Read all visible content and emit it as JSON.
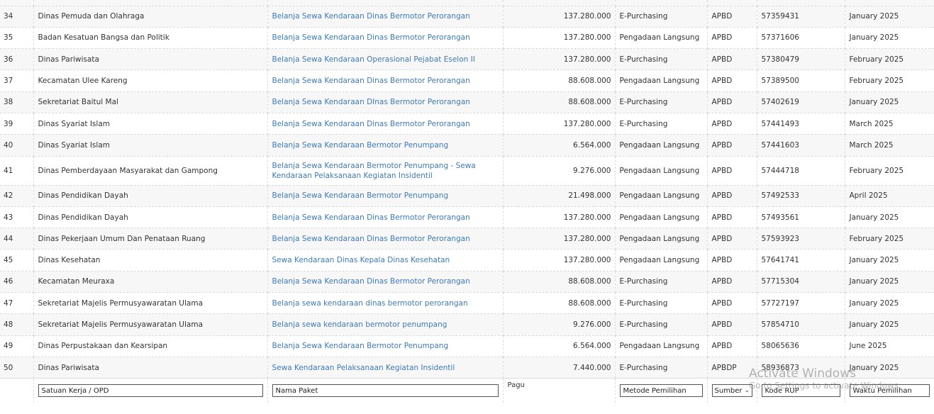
{
  "table": {
    "rows": [
      {
        "no": "34",
        "opd": "Dinas Pemuda dan Olahraga",
        "paket": "Belanja Sewa Kendaraan Dinas Bermotor Perorangan",
        "pagu": "137.280.000",
        "metode": "E-Purchasing",
        "sumber": "APBD",
        "kode": "57359431",
        "waktu": "January 2025"
      },
      {
        "no": "35",
        "opd": "Badan Kesatuan Bangsa dan Politik",
        "paket": "Belanja Sewa Kendaraan Dinas Bermotor Perorangan",
        "pagu": "137.280.000",
        "metode": "Pengadaan Langsung",
        "sumber": "APBD",
        "kode": "57371606",
        "waktu": "January 2025"
      },
      {
        "no": "36",
        "opd": "Dinas Pariwisata",
        "paket": "Belanja Sewa Kendaraan Operasional Pejabat Eselon II",
        "pagu": "137.280.000",
        "metode": "E-Purchasing",
        "sumber": "APBD",
        "kode": "57380479",
        "waktu": "February 2025"
      },
      {
        "no": "37",
        "opd": "Kecamatan Ulee Kareng",
        "paket": "Belanja Sewa Kendaraan Dinas Bermotor Perorangan",
        "pagu": "88.608.000",
        "metode": "Pengadaan Langsung",
        "sumber": "APBD",
        "kode": "57389500",
        "waktu": "February 2025"
      },
      {
        "no": "38",
        "opd": "Sekretariat Baitul Mal",
        "paket": "Belanja Sewa Kendaraan DInas Bermotor Perorangan",
        "pagu": "88.608.000",
        "metode": "E-Purchasing",
        "sumber": "APBD",
        "kode": "57402619",
        "waktu": "January 2025"
      },
      {
        "no": "39",
        "opd": "Dinas Syariat Islam",
        "paket": "Belanja Sewa Kendaraan Dinas Bermotor Perorangan",
        "pagu": "137.280.000",
        "metode": "E-Purchasing",
        "sumber": "APBD",
        "kode": "57441493",
        "waktu": "March 2025"
      },
      {
        "no": "40",
        "opd": "Dinas Syariat Islam",
        "paket": "Belanja Sewa Kendaraan Bermotor Penumpang",
        "pagu": "6.564.000",
        "metode": "Pengadaan Langsung",
        "sumber": "APBD",
        "kode": "57441603",
        "waktu": "March 2025"
      },
      {
        "no": "41",
        "opd": "Dinas Pemberdayaan Masyarakat dan Gampong",
        "paket": "Belanja Sewa Kendaraan Bermotor Penumpang - Sewa Kendaraan Pelaksanaan Kegiatan Insidentil",
        "pagu": "9.276.000",
        "metode": "Pengadaan Langsung",
        "sumber": "APBD",
        "kode": "57444718",
        "waktu": "February 2025"
      },
      {
        "no": "42",
        "opd": "Dinas Pendidikan Dayah",
        "paket": "Belanja Sewa Kendaraan Bermotor Penumpang",
        "pagu": "21.498.000",
        "metode": "Pengadaan Langsung",
        "sumber": "APBD",
        "kode": "57492533",
        "waktu": "April 2025"
      },
      {
        "no": "43",
        "opd": "Dinas Pendidikan Dayah",
        "paket": "Belanja Sewa Kendaraan Dinas Bermotor Perorangan",
        "pagu": "137.280.000",
        "metode": "Pengadaan Langsung",
        "sumber": "APBD",
        "kode": "57493561",
        "waktu": "January 2025"
      },
      {
        "no": "44",
        "opd": "Dinas Pekerjaan Umum Dan Penataan Ruang",
        "paket": "Belanja Sewa Kendaraan Dinas Bermotor Perorangan",
        "pagu": "137.280.000",
        "metode": "Pengadaan Langsung",
        "sumber": "APBD",
        "kode": "57593923",
        "waktu": "February 2025"
      },
      {
        "no": "45",
        "opd": "Dinas Kesehatan",
        "paket": "Sewa Kendaraan Dinas Kepala Dinas Kesehatan",
        "pagu": "137.280.000",
        "metode": "Pengadaan Langsung",
        "sumber": "APBD",
        "kode": "57641741",
        "waktu": "January 2025"
      },
      {
        "no": "46",
        "opd": "Kecamatan Meuraxa",
        "paket": "Belanja Sewa Kendaraan Dinas Bermotor Perorangan",
        "pagu": "88.608.000",
        "metode": "E-Purchasing",
        "sumber": "APBD",
        "kode": "57715304",
        "waktu": "January 2025"
      },
      {
        "no": "47",
        "opd": "Sekretariat Majelis Permusyawaratan Ulama",
        "paket": "Belanja sewa kendaraan dinas bermotor perorangan",
        "pagu": "88.608.000",
        "metode": "E-Purchasing",
        "sumber": "APBD",
        "kode": "57727197",
        "waktu": "January 2025"
      },
      {
        "no": "48",
        "opd": "Sekretariat Majelis Permusyawaratan Ulama",
        "paket": "Belanja sewa kendaraan bermotor penumpang",
        "pagu": "9.276.000",
        "metode": "E-Purchasing",
        "sumber": "APBD",
        "kode": "57854710",
        "waktu": "January 2025"
      },
      {
        "no": "49",
        "opd": "Dinas Perpustakaan dan Kearsipan",
        "paket": "Belanja Sewa Kendaraan Bermotor Penumpang",
        "pagu": "6.564.000",
        "metode": "Pengadaan Langsung",
        "sumber": "APBD",
        "kode": "58065636",
        "waktu": "June 2025"
      },
      {
        "no": "50",
        "opd": "Dinas Pariwisata",
        "paket": "Sewa Kendaraan Pelaksanaan Kegiatan Insidentil",
        "pagu": "7.440.000",
        "metode": "E-Purchasing",
        "sumber": "APBDP",
        "kode": "58936873",
        "waktu": "January 2025"
      }
    ]
  },
  "filters": {
    "opd_placeholder": "Satuan Kerja / OPD",
    "paket_placeholder": "Nama Paket",
    "pagu_label": "Pagu",
    "metode_placeholder": "Metode Pemilihan",
    "sumber_value": "Sumber",
    "kode_placeholder": "Kode RUP",
    "waktu_placeholder": "Waktu Pemilihan"
  },
  "watermark": {
    "title": "Activate Windows",
    "subtitle": "Go to Settings to activate Windows."
  },
  "icons": {
    "sumber_dropdown": "chevron-down-icon"
  },
  "colors": {
    "link": "#3d7ab8",
    "row_alt": "#f7f7f7"
  }
}
